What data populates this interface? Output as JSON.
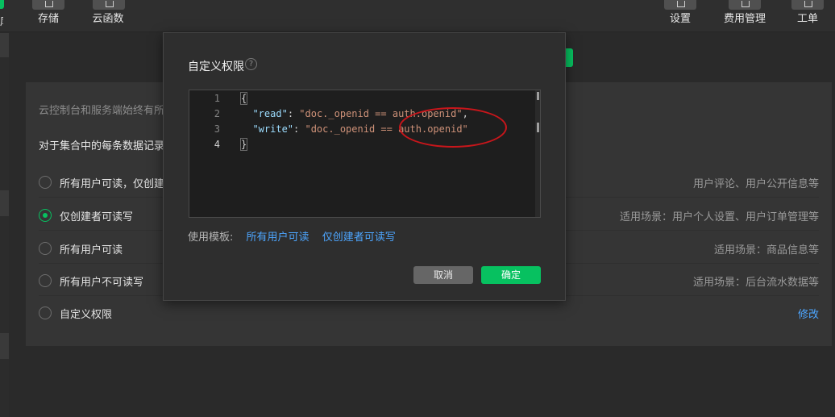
{
  "toolbar": {
    "left_items": [
      {
        "label": "存储",
        "icon": "storage-icon"
      },
      {
        "label": "云函数",
        "icon": "cloud-function-icon"
      }
    ],
    "right_items": [
      {
        "label": "设置",
        "icon": "settings-icon"
      },
      {
        "label": "费用管理",
        "icon": "billing-icon"
      },
      {
        "label": "工单",
        "icon": "ticket-icon"
      }
    ],
    "edge_label": "库"
  },
  "panel": {
    "note": "云控制台和服务端始终有所",
    "subtitle": "对于集合中的每条数据记录",
    "options": [
      {
        "label": "所有用户可读，仅创建",
        "hint": "用户评论、用户公开信息等",
        "selected": false
      },
      {
        "label": "仅创建者可读写",
        "hint": "适用场景：用户个人设置、用户订单管理等",
        "selected": true
      },
      {
        "label": "所有用户可读",
        "hint": "适用场景：商品信息等",
        "selected": false
      },
      {
        "label": "所有用户不可读写",
        "hint": "适用场景：后台流水数据等",
        "selected": false
      },
      {
        "label": "自定义权限",
        "link": "修改",
        "selected": false
      }
    ]
  },
  "modal": {
    "title": "自定义权限",
    "help_glyph": "?",
    "editor": {
      "line_numbers": [
        "1",
        "2",
        "3",
        "4"
      ],
      "lines": {
        "l1": "{",
        "l2_key": "\"read\"",
        "l2_sep": ": ",
        "l2_val": "\"doc._openid == auth.openid\"",
        "l2_end": ",",
        "l3_key": "\"write\"",
        "l3_sep": ": ",
        "l3_val": "\"doc._openid == auth.openid\"",
        "l4": "}"
      }
    },
    "templates_label": "使用模板:",
    "templates": [
      "所有用户可读",
      "仅创建者可读写"
    ],
    "cancel_label": "取消",
    "ok_label": "确定"
  },
  "colors": {
    "accent": "#07c160",
    "link": "#4da6ff",
    "annotation": "#c8161b"
  }
}
